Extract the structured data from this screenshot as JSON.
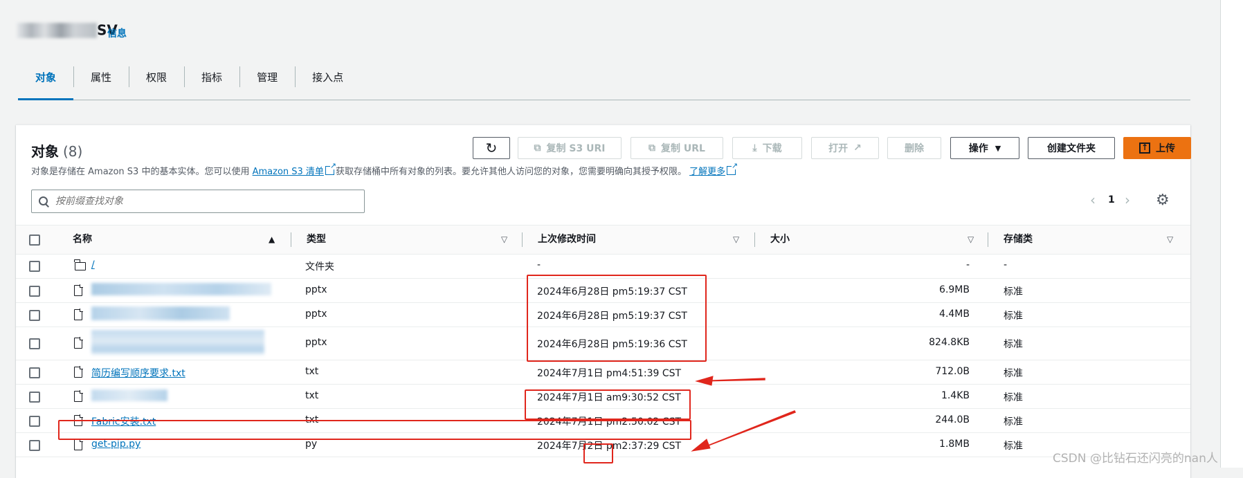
{
  "header": {
    "bucket_name_suffix": "SV",
    "info_link": "信息"
  },
  "tabs": [
    {
      "label": "对象",
      "active": true
    },
    {
      "label": "属性",
      "active": false
    },
    {
      "label": "权限",
      "active": false
    },
    {
      "label": "指标",
      "active": false
    },
    {
      "label": "管理",
      "active": false
    },
    {
      "label": "接入点",
      "active": false
    }
  ],
  "panel": {
    "title": "对象",
    "count": "(8)",
    "desc_prefix": "对象是存储在 Amazon S3 中的基本实体。您可以使用",
    "desc_link1": "Amazon S3 清单",
    "desc_middle": "获取存储桶中所有对象的列表。要允许其他人访问您的对象，您需要明确向其授予权限。",
    "desc_link2": "了解更多",
    "search_placeholder": "按前缀查找对象",
    "page_number": "1"
  },
  "toolbar": {
    "refresh_icon": "refresh-icon",
    "copy_s3_uri": "复制 S3 URI",
    "copy_url": "复制 URL",
    "download": "下载",
    "open": "打开",
    "delete": "删除",
    "actions": "操作",
    "create_folder": "创建文件夹",
    "upload": "上传"
  },
  "table": {
    "columns": {
      "name": "名称",
      "type": "类型",
      "last_modified": "上次修改时间",
      "size": "大小",
      "storage_class": "存储类"
    },
    "rows": [
      {
        "name": "/",
        "type": "文件夹",
        "modified": "-",
        "size": "-",
        "storage": "-",
        "icon": "folder-icon",
        "blurred": false
      },
      {
        "name": "",
        "type": "pptx",
        "modified": "2024年6月28日 pm5:19:37 CST",
        "size": "6.9MB",
        "storage": "标准",
        "icon": "file-icon",
        "blurred": true
      },
      {
        "name": "",
        "type": "pptx",
        "modified": "2024年6月28日 pm5:19:37 CST",
        "size": "4.4MB",
        "storage": "标准",
        "icon": "file-icon",
        "blurred": true
      },
      {
        "name": "",
        "type": "pptx",
        "modified": "2024年6月28日 pm5:19:36 CST",
        "size": "824.8KB",
        "storage": "标准",
        "icon": "file-icon",
        "blurred": true
      },
      {
        "name": "简历编写顺序要求.txt",
        "type": "txt",
        "modified": "2024年7月1日 pm4:51:39 CST",
        "size": "712.0B",
        "storage": "标准",
        "icon": "file-icon",
        "blurred": false
      },
      {
        "name": "",
        "type": "txt",
        "modified": "2024年7月1日 am9:30:52 CST",
        "size": "1.4KB",
        "storage": "标准",
        "icon": "file-icon",
        "blurred": true
      },
      {
        "name": "Fabric安装.txt",
        "type": "txt",
        "modified": "2024年7月1日 pm2:50:02 CST",
        "size": "244.0B",
        "storage": "标准",
        "icon": "file-icon",
        "blurred": false
      },
      {
        "name": "get-pip.py",
        "type": "py",
        "modified": "2024年7月2日 pm2:37:29 CST",
        "size": "1.8MB",
        "storage": "标准",
        "icon": "file-icon",
        "blurred": false
      }
    ]
  },
  "annotation_color": "#e0261c",
  "watermark": "CSDN @比钻石还闪亮的nan人"
}
